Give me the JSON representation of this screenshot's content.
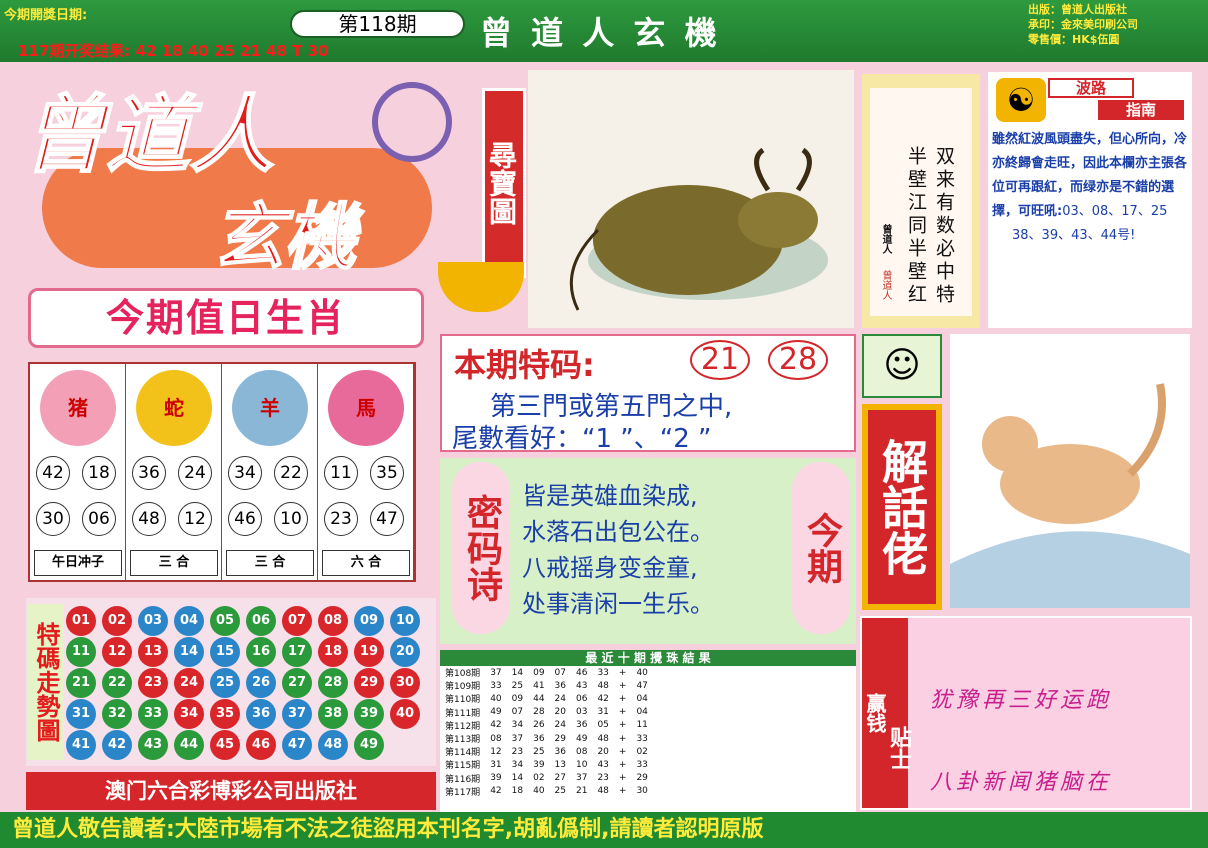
{
  "header": {
    "open_date_label": "今期開獎日期:",
    "issue": "第118期",
    "last_result": "117期开奖结果: 42 18 40 25 21 48 T 30",
    "brand": "曾 道 人 玄 機",
    "publisher": "出版：曾道人出版社",
    "printer": "承印：金來美印刷公司",
    "price": "零售價：HK$伍圓"
  },
  "logo": {
    "line1": "曾道人",
    "line2": "玄機",
    "badge": "尋寶圖"
  },
  "zodiac": {
    "title": "今期值日生肖",
    "animals": [
      {
        "name": "猪",
        "numbers": [
          "42",
          "18",
          "30",
          "06"
        ],
        "rule": "午日冲子"
      },
      {
        "name": "蛇",
        "numbers": [
          "36",
          "24",
          "48",
          "12"
        ],
        "rule": "三 合"
      },
      {
        "name": "羊",
        "numbers": [
          "34",
          "22",
          "46",
          "10"
        ],
        "rule": "三 合"
      },
      {
        "name": "馬",
        "numbers": [
          "11",
          "35",
          "23",
          "47"
        ],
        "rule": "六 合"
      }
    ]
  },
  "trend": {
    "title": "特碼走勢圖",
    "balls": [
      {
        "n": "01",
        "c": "red"
      },
      {
        "n": "02",
        "c": "red"
      },
      {
        "n": "03",
        "c": "blue"
      },
      {
        "n": "04",
        "c": "blue"
      },
      {
        "n": "05",
        "c": "green"
      },
      {
        "n": "06",
        "c": "green"
      },
      {
        "n": "07",
        "c": "red"
      },
      {
        "n": "08",
        "c": "red"
      },
      {
        "n": "09",
        "c": "blue"
      },
      {
        "n": "10",
        "c": "blue"
      },
      {
        "n": "11",
        "c": "green"
      },
      {
        "n": "12",
        "c": "red"
      },
      {
        "n": "13",
        "c": "red"
      },
      {
        "n": "14",
        "c": "blue"
      },
      {
        "n": "15",
        "c": "blue"
      },
      {
        "n": "16",
        "c": "green"
      },
      {
        "n": "17",
        "c": "green"
      },
      {
        "n": "18",
        "c": "red"
      },
      {
        "n": "19",
        "c": "red"
      },
      {
        "n": "20",
        "c": "blue"
      },
      {
        "n": "21",
        "c": "green"
      },
      {
        "n": "22",
        "c": "green"
      },
      {
        "n": "23",
        "c": "red"
      },
      {
        "n": "24",
        "c": "red"
      },
      {
        "n": "25",
        "c": "blue"
      },
      {
        "n": "26",
        "c": "blue"
      },
      {
        "n": "27",
        "c": "green"
      },
      {
        "n": "28",
        "c": "green"
      },
      {
        "n": "29",
        "c": "red"
      },
      {
        "n": "30",
        "c": "red"
      },
      {
        "n": "31",
        "c": "blue"
      },
      {
        "n": "32",
        "c": "green"
      },
      {
        "n": "33",
        "c": "green"
      },
      {
        "n": "34",
        "c": "red"
      },
      {
        "n": "35",
        "c": "red"
      },
      {
        "n": "36",
        "c": "blue"
      },
      {
        "n": "37",
        "c": "blue"
      },
      {
        "n": "38",
        "c": "green"
      },
      {
        "n": "39",
        "c": "green"
      },
      {
        "n": "40",
        "c": "red"
      },
      {
        "n": "41",
        "c": "blue"
      },
      {
        "n": "42",
        "c": "blue"
      },
      {
        "n": "43",
        "c": "green"
      },
      {
        "n": "44",
        "c": "green"
      },
      {
        "n": "45",
        "c": "red"
      },
      {
        "n": "46",
        "c": "red"
      },
      {
        "n": "47",
        "c": "blue"
      },
      {
        "n": "48",
        "c": "blue"
      },
      {
        "n": "49",
        "c": "green"
      }
    ],
    "publisher": "澳门六合彩博彩公司出版社"
  },
  "poem_box": {
    "side": "曾道人",
    "signature": "曾道人",
    "line1": "双来有数必中特",
    "line2": "半壁江同半壁红"
  },
  "wave": {
    "title1": "波路",
    "title2": "指南",
    "text": "雖然紅波風頭盡失，但心所向，冷亦終歸會走旺，因此本欄亦主張各位可再跟",
    "red_word": "紅",
    "mid": "，而",
    "green_word": "绿",
    "tail": "亦是不錯的選擇，可旺吼:",
    "numbers1": "03、08、17、25",
    "numbers2": "38、39、43、44号!"
  },
  "special": {
    "label": "本期特码:",
    "num1": "21",
    "num2": "28",
    "line1": "第三門或第五門之中,",
    "line2": "尾數看好：“1 ”、“2 ”"
  },
  "password_poem": {
    "left": "密码诗",
    "right": "今期",
    "lines": [
      "皆是英雄血染成,",
      "水落石出包公在。",
      "八戒摇身变金童,",
      "处事清闲一生乐。"
    ]
  },
  "history": {
    "title": "最 近 十 期 攪 珠 結 果",
    "rows": [
      [
        "第108期",
        "37",
        "14",
        "09",
        "07",
        "46",
        "33",
        "+",
        "40"
      ],
      [
        "第109期",
        "33",
        "25",
        "41",
        "36",
        "43",
        "48",
        "+",
        "47"
      ],
      [
        "第110期",
        "40",
        "09",
        "44",
        "24",
        "06",
        "42",
        "+",
        "04"
      ],
      [
        "第111期",
        "49",
        "07",
        "28",
        "20",
        "03",
        "31",
        "+",
        "04"
      ],
      [
        "第112期",
        "42",
        "34",
        "26",
        "24",
        "36",
        "05",
        "+",
        "11"
      ],
      [
        "第113期",
        "08",
        "37",
        "36",
        "29",
        "49",
        "48",
        "+",
        "33"
      ],
      [
        "第114期",
        "12",
        "23",
        "25",
        "36",
        "08",
        "20",
        "+",
        "02"
      ],
      [
        "第115期",
        "31",
        "34",
        "39",
        "13",
        "10",
        "43",
        "+",
        "33"
      ],
      [
        "第116期",
        "39",
        "14",
        "02",
        "27",
        "37",
        "23",
        "+",
        "29"
      ],
      [
        "第117期",
        "42",
        "18",
        "40",
        "25",
        "21",
        "48",
        "+",
        "30"
      ]
    ]
  },
  "jiehua": {
    "title": "解話佬"
  },
  "tips": {
    "label1": "赢钱",
    "label2": "贴士",
    "line1": "犹豫再三好运跑",
    "line2": "八卦新闻猪脑在"
  },
  "footer": "曾道人敬告讀者:大陸市場有不法之徒盜用本刊名字,胡亂僞制,請讀者認明原版"
}
